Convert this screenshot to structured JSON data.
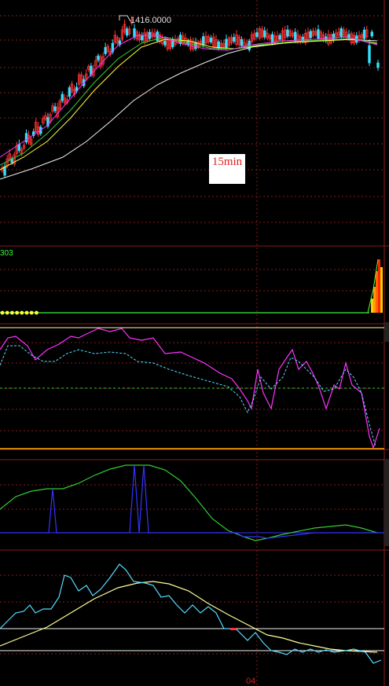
{
  "chart_data": {
    "type": "candlestick",
    "period_label": "15min",
    "peak_label": "1416.0000",
    "indicator_label": "303",
    "x_tick_label": "04",
    "colors": {
      "background": "#000000",
      "grid": "#8b1a1a",
      "up": "#ff3333",
      "down": "#33e0ff",
      "ma_white": "#f0f0f0",
      "ma_yellow": "#ffff33",
      "ma_green": "#33cc33",
      "ma_magenta": "#ff33ff",
      "cyan": "#55ddff",
      "blue": "#3333ff"
    }
  }
}
